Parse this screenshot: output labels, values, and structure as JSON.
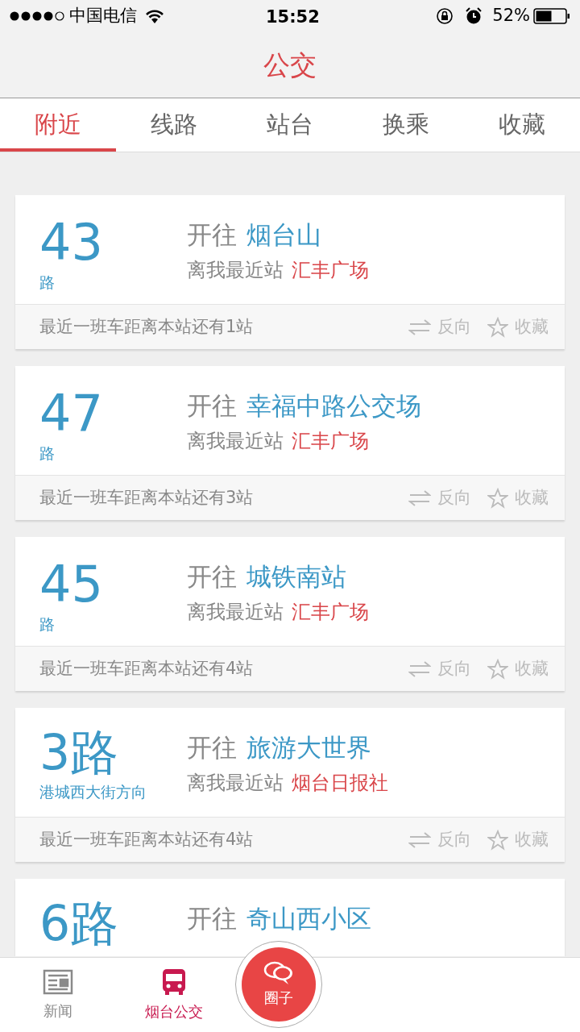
{
  "status_bar": {
    "carrier": "中国电信",
    "time": "15:52",
    "battery": "52%"
  },
  "header": {
    "title": "公交"
  },
  "tabs": [
    {
      "label": "附近",
      "selected": true
    },
    {
      "label": "线路",
      "selected": false
    },
    {
      "label": "站台",
      "selected": false
    },
    {
      "label": "换乘",
      "selected": false
    },
    {
      "label": "收藏",
      "selected": false
    }
  ],
  "routes": [
    {
      "number": "43",
      "sub": "路",
      "kind": "short",
      "prefix": "开往",
      "destination": "烟台山",
      "nearest_label": "离我最近站",
      "nearest_stop": "汇丰广场",
      "arrival": "最近一班车距离本站还有1站",
      "reverse": "反向",
      "favorite": "收藏"
    },
    {
      "number": "47",
      "sub": "路",
      "kind": "short",
      "prefix": "开往",
      "destination": "幸福中路公交场",
      "nearest_label": "离我最近站",
      "nearest_stop": "汇丰广场",
      "arrival": "最近一班车距离本站还有3站",
      "reverse": "反向",
      "favorite": "收藏"
    },
    {
      "number": "45",
      "sub": "路",
      "kind": "short",
      "prefix": "开往",
      "destination": "城铁南站",
      "nearest_label": "离我最近站",
      "nearest_stop": "汇丰广场",
      "arrival": "最近一班车距离本站还有4站",
      "reverse": "反向",
      "favorite": "收藏"
    },
    {
      "number": "3路",
      "sub": "港城西大街方向",
      "kind": "long",
      "prefix": "开往",
      "destination": "旅游大世界",
      "nearest_label": "离我最近站",
      "nearest_stop": "烟台日报社",
      "arrival": "最近一班车距离本站还有4站",
      "reverse": "反向",
      "favorite": "收藏"
    },
    {
      "number": "6路",
      "kind": "long",
      "prefix": "开往",
      "destination": "奇山西小区"
    }
  ],
  "bottom_nav": [
    {
      "kind": "news",
      "label": "新闻",
      "selected": false
    },
    {
      "kind": "bus",
      "label": "烟台公交",
      "selected": true
    },
    {
      "kind": "center",
      "label": "圈子",
      "selected": false
    }
  ]
}
